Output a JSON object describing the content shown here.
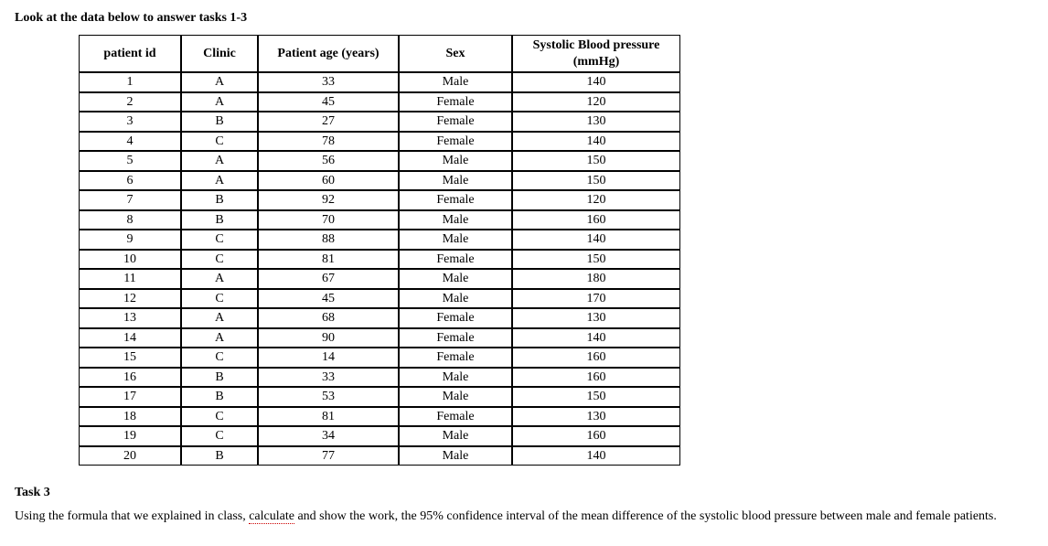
{
  "intro": "Look at the data below to answer tasks 1-3",
  "columns": {
    "id": "patient id",
    "clinic": "Clinic",
    "age": "Patient age (years)",
    "sex": "Sex",
    "bp_line1": "Systolic Blood pressure",
    "bp_line2": "(mmHg)"
  },
  "rows": [
    {
      "id": "1",
      "clinic": "A",
      "age": "33",
      "sex": "Male",
      "bp": "140"
    },
    {
      "id": "2",
      "clinic": "A",
      "age": "45",
      "sex": "Female",
      "bp": "120"
    },
    {
      "id": "3",
      "clinic": "B",
      "age": "27",
      "sex": "Female",
      "bp": "130"
    },
    {
      "id": "4",
      "clinic": "C",
      "age": "78",
      "sex": "Female",
      "bp": "140"
    },
    {
      "id": "5",
      "clinic": "A",
      "age": "56",
      "sex": "Male",
      "bp": "150"
    },
    {
      "id": "6",
      "clinic": "A",
      "age": "60",
      "sex": "Male",
      "bp": "150"
    },
    {
      "id": "7",
      "clinic": "B",
      "age": "92",
      "sex": "Female",
      "bp": "120"
    },
    {
      "id": "8",
      "clinic": "B",
      "age": "70",
      "sex": "Male",
      "bp": "160"
    },
    {
      "id": "9",
      "clinic": "C",
      "age": "88",
      "sex": "Male",
      "bp": "140"
    },
    {
      "id": "10",
      "clinic": "C",
      "age": "81",
      "sex": "Female",
      "bp": "150"
    },
    {
      "id": "11",
      "clinic": "A",
      "age": "67",
      "sex": "Male",
      "bp": "180"
    },
    {
      "id": "12",
      "clinic": "C",
      "age": "45",
      "sex": "Male",
      "bp": "170"
    },
    {
      "id": "13",
      "clinic": "A",
      "age": "68",
      "sex": "Female",
      "bp": "130"
    },
    {
      "id": "14",
      "clinic": "A",
      "age": "90",
      "sex": "Female",
      "bp": "140"
    },
    {
      "id": "15",
      "clinic": "C",
      "age": "14",
      "sex": "Female",
      "bp": "160"
    },
    {
      "id": "16",
      "clinic": "B",
      "age": "33",
      "sex": "Male",
      "bp": "160"
    },
    {
      "id": "17",
      "clinic": "B",
      "age": "53",
      "sex": "Male",
      "bp": "150"
    },
    {
      "id": "18",
      "clinic": "C",
      "age": "81",
      "sex": "Female",
      "bp": "130"
    },
    {
      "id": "19",
      "clinic": "C",
      "age": "34",
      "sex": "Male",
      "bp": "160"
    },
    {
      "id": "20",
      "clinic": "B",
      "age": "77",
      "sex": "Male",
      "bp": "140"
    }
  ],
  "task": {
    "heading": "Task 3",
    "prefix": "Using the formula that we explained in class, ",
    "calculate_word": "calculate",
    "suffix": " and show the work, the 95% confidence interval of the mean difference of the systolic blood pressure between male and female patients."
  }
}
